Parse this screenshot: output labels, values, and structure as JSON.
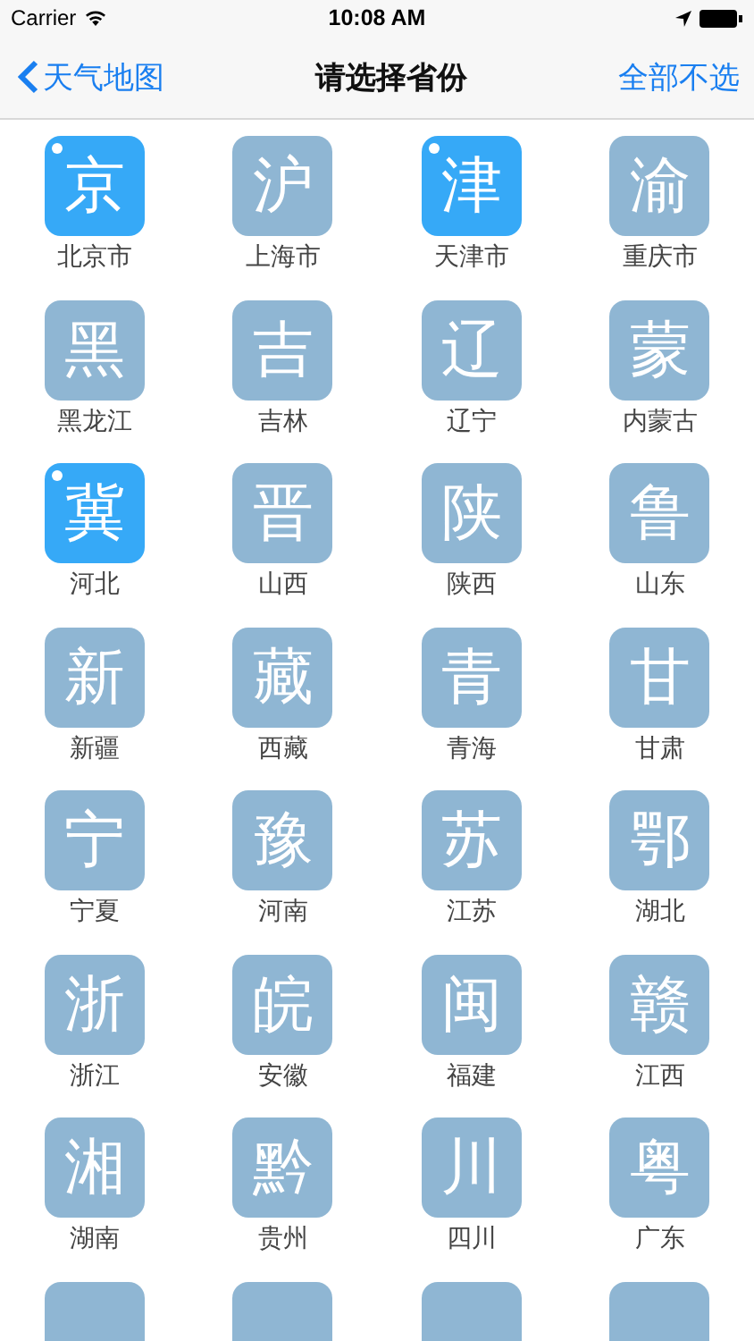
{
  "status_bar": {
    "carrier": "Carrier",
    "time": "10:08 AM"
  },
  "nav_bar": {
    "back": "天气地图",
    "title": "请选择省份",
    "action": "全部不选"
  },
  "provinces": [
    {
      "char": "京",
      "name": "北京市",
      "selected": true
    },
    {
      "char": "沪",
      "name": "上海市",
      "selected": false
    },
    {
      "char": "津",
      "name": "天津市",
      "selected": true
    },
    {
      "char": "渝",
      "name": "重庆市",
      "selected": false
    },
    {
      "char": "黑",
      "name": "黑龙江",
      "selected": false
    },
    {
      "char": "吉",
      "name": "吉林",
      "selected": false
    },
    {
      "char": "辽",
      "name": "辽宁",
      "selected": false
    },
    {
      "char": "蒙",
      "name": "内蒙古",
      "selected": false
    },
    {
      "char": "冀",
      "name": "河北",
      "selected": true
    },
    {
      "char": "晋",
      "name": "山西",
      "selected": false
    },
    {
      "char": "陕",
      "name": "陕西",
      "selected": false
    },
    {
      "char": "鲁",
      "name": "山东",
      "selected": false
    },
    {
      "char": "新",
      "name": "新疆",
      "selected": false
    },
    {
      "char": "藏",
      "name": "西藏",
      "selected": false
    },
    {
      "char": "青",
      "name": "青海",
      "selected": false
    },
    {
      "char": "甘",
      "name": "甘肃",
      "selected": false
    },
    {
      "char": "宁",
      "name": "宁夏",
      "selected": false
    },
    {
      "char": "豫",
      "name": "河南",
      "selected": false
    },
    {
      "char": "苏",
      "name": "江苏",
      "selected": false
    },
    {
      "char": "鄂",
      "name": "湖北",
      "selected": false
    },
    {
      "char": "浙",
      "name": "浙江",
      "selected": false
    },
    {
      "char": "皖",
      "name": "安徽",
      "selected": false
    },
    {
      "char": "闽",
      "name": "福建",
      "selected": false
    },
    {
      "char": "赣",
      "name": "江西",
      "selected": false
    },
    {
      "char": "湘",
      "name": "湖南",
      "selected": false
    },
    {
      "char": "黔",
      "name": "贵州",
      "selected": false
    },
    {
      "char": "川",
      "name": "四川",
      "selected": false
    },
    {
      "char": "粤",
      "name": "广东",
      "selected": false
    },
    {
      "selected": false
    },
    {
      "selected": false
    },
    {
      "selected": false
    },
    {
      "selected": false
    }
  ]
}
